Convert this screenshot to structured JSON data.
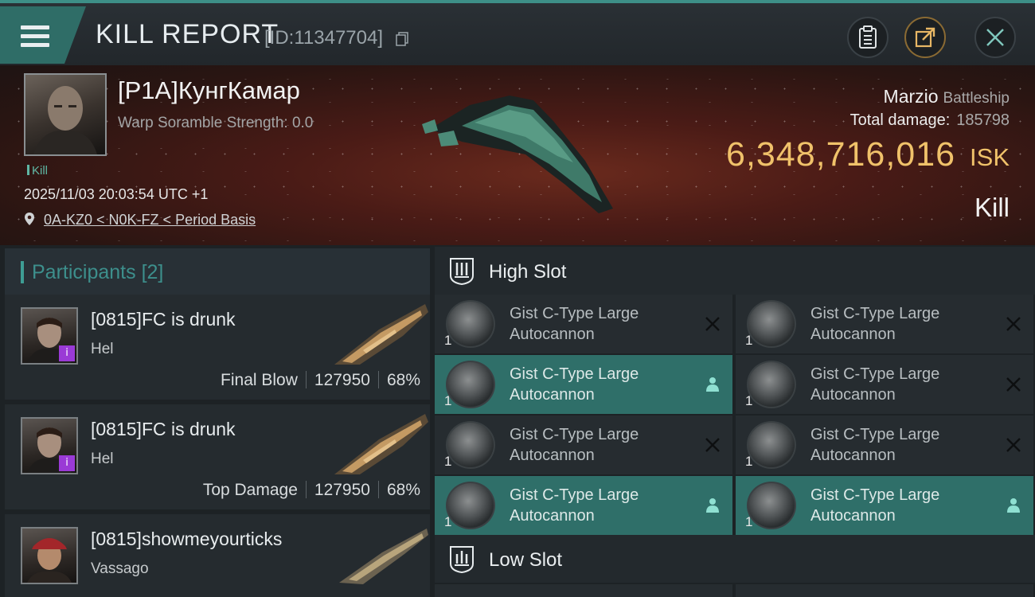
{
  "header": {
    "title": "KILL REPORT",
    "report_id": "[ID:11347704]"
  },
  "icons": {
    "menu": "menu-icon",
    "copy": "copy-icon",
    "clipboard": "clipboard-icon",
    "share": "share-icon",
    "close": "close-icon"
  },
  "victim": {
    "name": "[P1A]КунгКамар",
    "warp_scramble": "Warp Soramble Strength: 0.0",
    "kill_tag": "Kill",
    "datetime": "2025/11/03 20:03:54 UTC +1",
    "location": "0A-KZ0 < N0K-FZ < Period Basis",
    "ship_name": "Marzio",
    "ship_class": "Battleship",
    "total_damage_label": "Total damage:",
    "total_damage": "185798",
    "isk_value": "6,348,716,016",
    "isk_unit": "ISK",
    "result": "Kill"
  },
  "participants": {
    "label": "Participants",
    "count": "[2]",
    "rows": [
      {
        "name": "[0815]FC is drunk",
        "ship": "Hel",
        "role": "Final Blow",
        "damage": "127950",
        "percent": "68%",
        "badge": "i"
      },
      {
        "name": "[0815]FC is drunk",
        "ship": "Hel",
        "role": "Top Damage",
        "damage": "127950",
        "percent": "68%",
        "badge": "i"
      },
      {
        "name": "[0815]showmeyourticks",
        "ship": "Vassago"
      }
    ]
  },
  "slots": {
    "high_label": "High Slot",
    "low_label": "Low Slot",
    "high_modules": [
      {
        "line1": "Gist C-Type Large",
        "line2": "Autocannon",
        "qty": "1",
        "status": "destroyed"
      },
      {
        "line1": "Gist C-Type Large",
        "line2": "Autocannon",
        "qty": "1",
        "status": "destroyed"
      },
      {
        "line1": "Gist C-Type Large",
        "line2": "Autocannon",
        "qty": "1",
        "status": "dropped"
      },
      {
        "line1": "Gist C-Type Large",
        "line2": "Autocannon",
        "qty": "1",
        "status": "destroyed"
      },
      {
        "line1": "Gist C-Type Large",
        "line2": "Autocannon",
        "qty": "1",
        "status": "destroyed"
      },
      {
        "line1": "Gist C-Type Large",
        "line2": "Autocannon",
        "qty": "1",
        "status": "destroyed"
      },
      {
        "line1": "Gist C-Type Large",
        "line2": "Autocannon",
        "qty": "1",
        "status": "dropped"
      },
      {
        "line1": "Gist C-Type Large",
        "line2": "Autocannon",
        "qty": "1",
        "status": "dropped"
      }
    ]
  },
  "colors": {
    "accent": "#3e9d94",
    "isk": "#f0c26a",
    "active_row": "#2f6f69",
    "badge": "#9a3ad6"
  }
}
